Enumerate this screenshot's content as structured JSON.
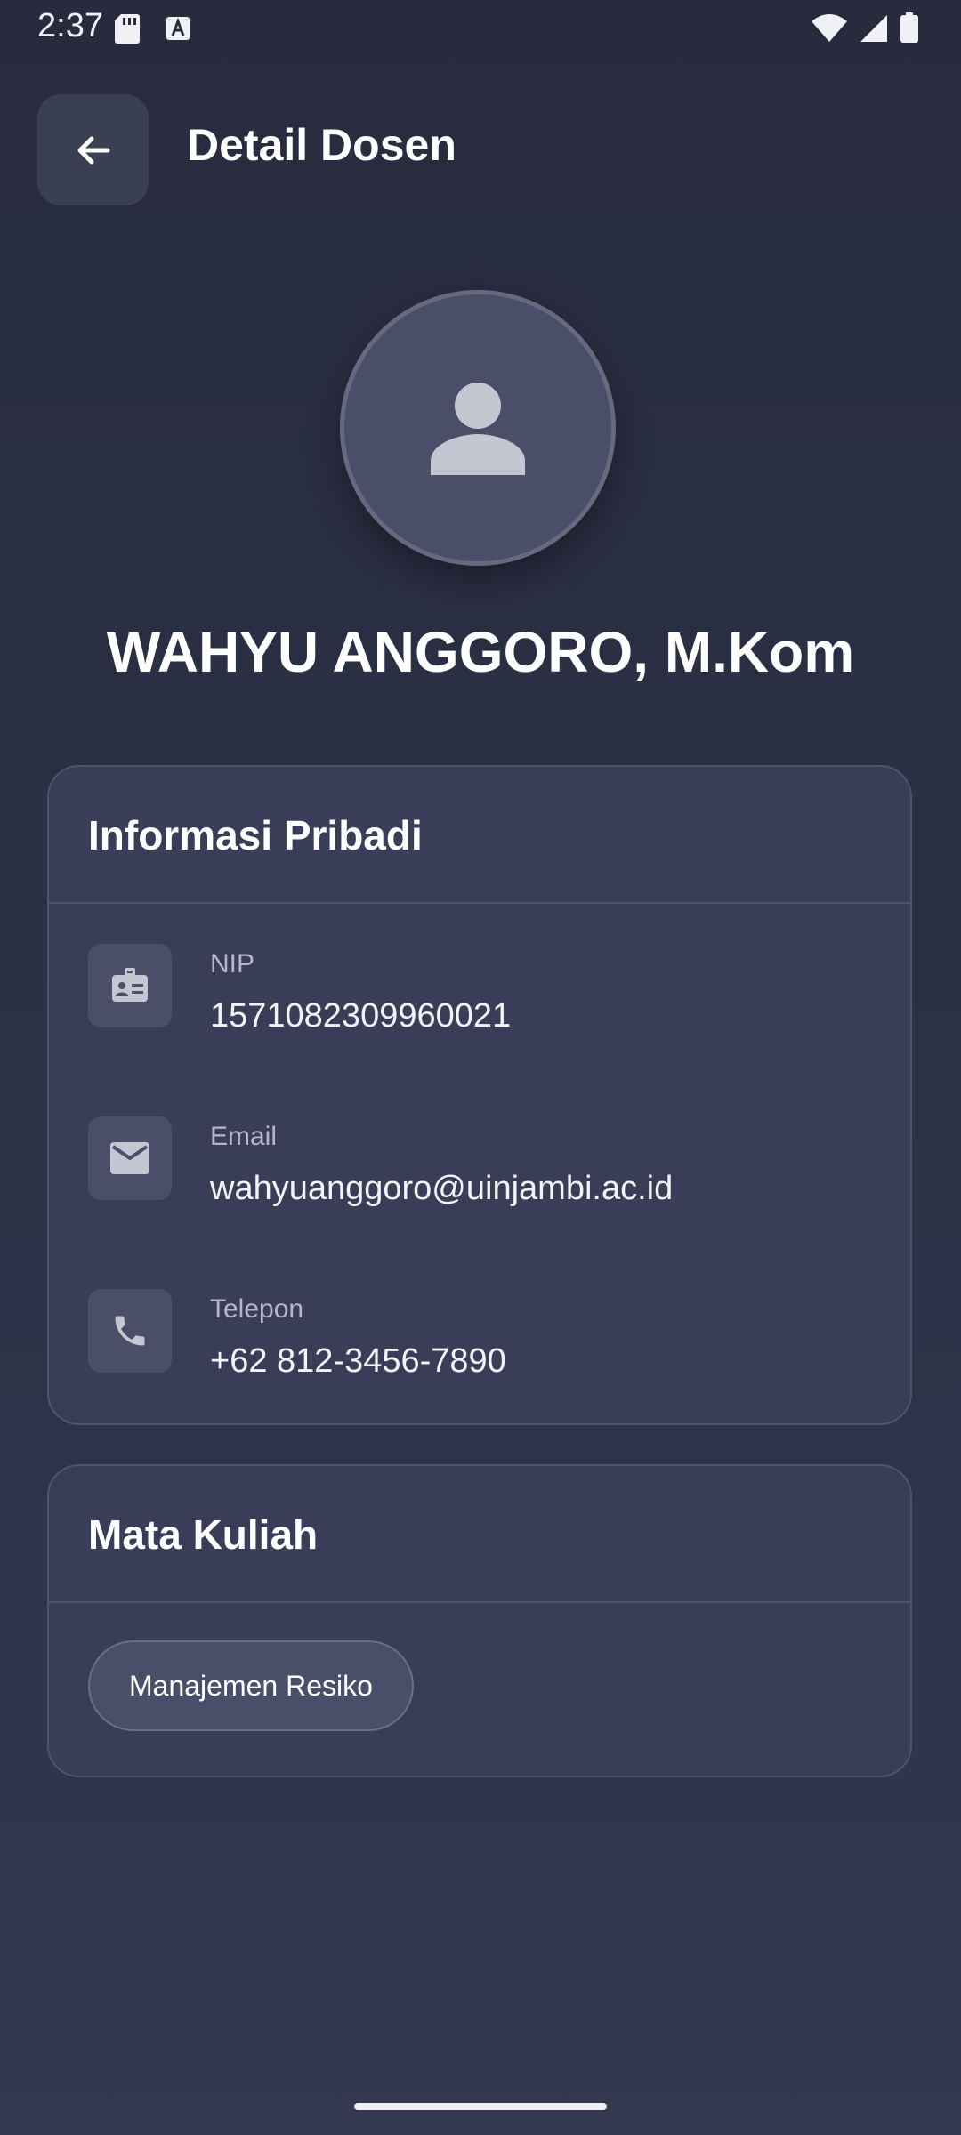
{
  "status_bar": {
    "time": "2:37"
  },
  "header": {
    "title": "Detail Dosen"
  },
  "profile": {
    "name": "WAHYU ANGGORO, M.Kom"
  },
  "personal_info": {
    "title": "Informasi Pribadi",
    "items": [
      {
        "label": "NIP",
        "value": "1571082309960021",
        "icon": "id-badge-icon"
      },
      {
        "label": "Email",
        "value": "wahyuanggoro@uinjambi.ac.id",
        "icon": "mail-icon"
      },
      {
        "label": "Telepon",
        "value": "+62 812-3456-7890",
        "icon": "phone-icon"
      }
    ]
  },
  "courses": {
    "title": "Mata Kuliah",
    "items": [
      "Manajemen Resiko"
    ]
  },
  "colors": {
    "background": "#2d3146",
    "card": "#393d57",
    "icon_bg": "#4a4e68",
    "text": "#ffffff",
    "muted": "#b4b7c7"
  }
}
